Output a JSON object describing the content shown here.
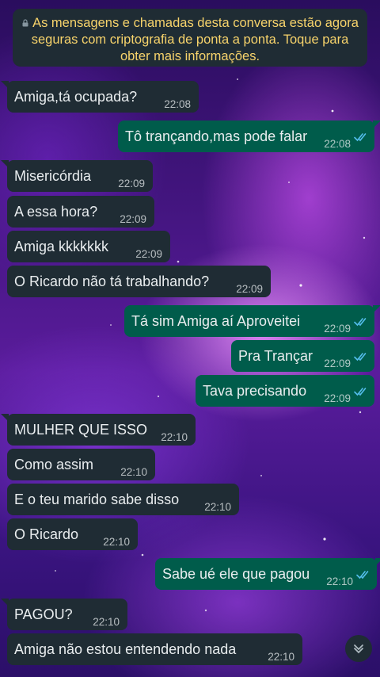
{
  "banner": {
    "text": "As mensagens e chamadas desta conversa estão agora seguras com criptografia de ponta a ponta. Toque para obter mais informações."
  },
  "messages": [
    {
      "dir": "in",
      "text": "Amiga,tá ocupada?",
      "time": "22:08"
    },
    {
      "dir": "out",
      "text": "Tô trançando,mas pode falar",
      "time": "22:08",
      "status": "read"
    },
    {
      "dir": "in",
      "text": "Misericórdia",
      "time": "22:09"
    },
    {
      "dir": "in",
      "text": "A essa hora?",
      "time": "22:09"
    },
    {
      "dir": "in",
      "text": "Amiga kkkkkkk",
      "time": "22:09"
    },
    {
      "dir": "in",
      "text": "O Ricardo não tá trabalhando?",
      "time": "22:09"
    },
    {
      "dir": "out",
      "text": "Tá sim Amiga aí Aproveitei",
      "time": "22:09",
      "status": "read"
    },
    {
      "dir": "out",
      "text": "Pra Trançar",
      "time": "22:09",
      "status": "read"
    },
    {
      "dir": "out",
      "text": "Tava precisando",
      "time": "22:09",
      "status": "read"
    },
    {
      "dir": "in",
      "text": "MULHER QUE ISSO",
      "time": "22:10"
    },
    {
      "dir": "in",
      "text": "Como assim",
      "time": "22:10"
    },
    {
      "dir": "in",
      "text": "E o teu marido sabe disso",
      "time": "22:10"
    },
    {
      "dir": "in",
      "text": "O Ricardo",
      "time": "22:10"
    },
    {
      "dir": "out",
      "text": "Sabe ué ele que pagou",
      "time": "22:10",
      "status": "read"
    },
    {
      "dir": "in",
      "text": "PAGOU?",
      "time": "22:10"
    },
    {
      "dir": "in",
      "text": "Amiga não estou entendendo nada",
      "time": "22:10"
    }
  ],
  "colors": {
    "incoming_bubble": "#1f2c34",
    "outgoing_bubble": "#005c4b",
    "banner_text": "#f7d36b",
    "read_check": "#53bdeb"
  },
  "icons": {
    "banner": "lock-icon",
    "read_status": "double-check-icon",
    "scroll": "chevron-down-double-icon"
  }
}
